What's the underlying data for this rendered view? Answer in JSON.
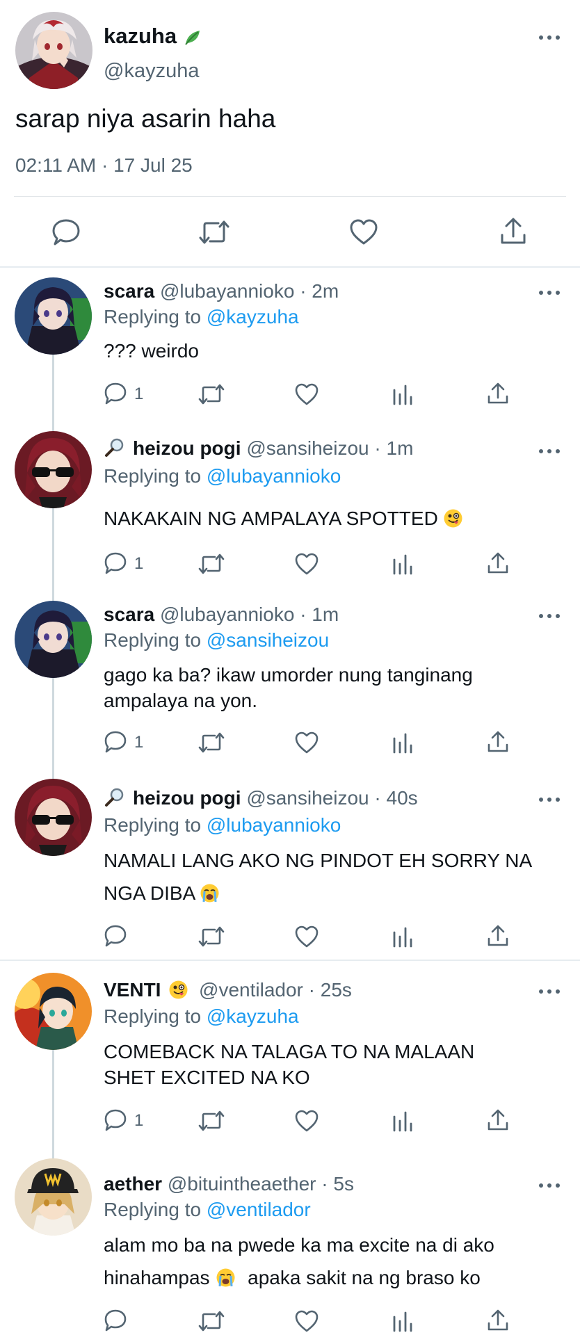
{
  "main_tweet": {
    "name": "kazuha",
    "handle": "@kayzuha",
    "text": "sarap niya asarin haha",
    "timestamp": "02:11 AM · 17 Jul 25",
    "name_badge_icon": "leaf-icon"
  },
  "replies": [
    {
      "name": "scara",
      "handle": "@lubayannioko",
      "time": "· 2m",
      "replying_label": "Replying to",
      "replying_to": "@kayzuha",
      "text": "??? weirdo",
      "reply_count": "1"
    },
    {
      "prefix_icon": "magnifier-icon",
      "name": "heizou pogi",
      "handle": "@sansiheizou",
      "time": "· 1m",
      "replying_label": "Replying to",
      "replying_to": "@lubayannioko",
      "text": "NAKAKAIN NG AMPALAYA SPOTTED",
      "text_emoji": "zany-face-emoji",
      "reply_count": "1"
    },
    {
      "name": "scara",
      "handle": "@lubayannioko",
      "time": "· 1m",
      "replying_label": "Replying to",
      "replying_to": "@sansiheizou",
      "text_line1": "gago ka ba? ikaw umorder nung tanginang",
      "text_line2": "ampalaya na yon.",
      "reply_count": "1"
    },
    {
      "prefix_icon": "magnifier-icon",
      "name": "heizou pogi",
      "handle": "@sansiheizou",
      "time": "· 40s",
      "replying_label": "Replying to",
      "replying_to": "@lubayannioko",
      "text_line1": "NAMALI LANG AKO NG PINDOT EH SORRY NA",
      "text_line2": "NGA DIBA",
      "text_emoji": "crying-face-emoji",
      "reply_count": ""
    },
    {
      "name": "VENTI",
      "name_emoji": "zany-face-emoji",
      "handle": "@ventilador",
      "time": "· 25s",
      "replying_label": "Replying to",
      "replying_to": "@kayzuha",
      "text_line1": "COMEBACK NA TALAGA TO NA MALAAN",
      "text_line2": "SHET EXCITED NA KO",
      "reply_count": "1"
    },
    {
      "name": "aether",
      "handle": "@bituintheaether",
      "time": "· 5s",
      "replying_label": "Replying to",
      "replying_to": "@ventilador",
      "text_line1": "alam mo ba na pwede ka ma excite na di ako",
      "text_line2a": "hinahampas",
      "text_emoji": "crying-face-emoji",
      "text_line2b": "apaka sakit na ng braso ko",
      "reply_count": ""
    }
  ],
  "colors": {
    "text": "#0f1419",
    "muted": "#536471",
    "link": "#1d9bf0",
    "divider": "#e6ecf0"
  }
}
